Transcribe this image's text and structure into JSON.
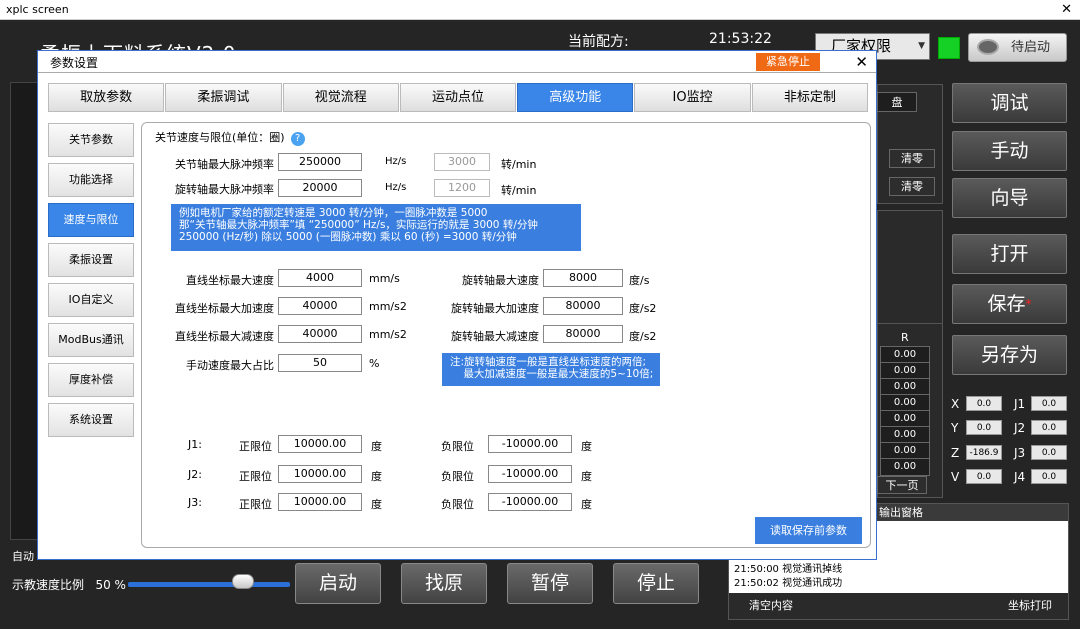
{
  "window": {
    "title": "xplc screen",
    "close": "✕"
  },
  "app": {
    "title": "柔振上下料系统V2.0",
    "recipe_label": "当前配方:",
    "clock": "21:53:22",
    "permission": "厂家权限",
    "status_button": "待启动",
    "auto_label": "自动",
    "speed_label": "示教速度比例",
    "speed_value": "50 %",
    "speed_fraction": 0.5,
    "side_buttons": [
      "调试",
      "手动",
      "向导",
      "打开",
      "保存",
      "另存为"
    ],
    "save_mark": "*",
    "partial_label": "盘",
    "clear_buttons": [
      "清零",
      "清零"
    ],
    "r_header": "R",
    "r_values": [
      "0.00",
      "0.00",
      "0.00",
      "0.00",
      "0.00",
      "0.00",
      "0.00",
      "0.00"
    ],
    "next_page": "下一页",
    "axes": [
      {
        "label": "X",
        "value": "0.0",
        "jlabel": "J1",
        "jvalue": "0.0"
      },
      {
        "label": "Y",
        "value": "0.0",
        "jlabel": "J2",
        "jvalue": "0.0"
      },
      {
        "label": "Z",
        "value": "-186.9",
        "jlabel": "J3",
        "jvalue": "0.0"
      },
      {
        "label": "V",
        "value": "0.0",
        "jlabel": "J4",
        "jvalue": "0.0"
      }
    ],
    "bottom_buttons": [
      "启动",
      "找原",
      "暂停",
      "停止"
    ],
    "log": {
      "title": "输出窗格",
      "lines": [
        "21:50:00  视觉通讯掉线",
        "21:50:02  视觉通讯成功"
      ],
      "clear": "清空内容",
      "print": "坐标打印"
    }
  },
  "dialog": {
    "title": "参数设置",
    "estop": "紧急停止",
    "close": "✕",
    "tabs": [
      "取放参数",
      "柔振调试",
      "视觉流程",
      "运动点位",
      "高级功能",
      "IO监控",
      "非标定制"
    ],
    "active_tab": 4,
    "sidebar": [
      "关节参数",
      "功能选择",
      "速度与限位",
      "柔振设置",
      "IO自定义",
      "ModBus通讯",
      "厚度补偿",
      "系统设置"
    ],
    "active_side": 2,
    "section_title": "关节速度与限位(单位：圈)",
    "help": "?",
    "pulse_rows": [
      {
        "label": "关节轴最大脉冲频率",
        "value": "250000",
        "unit": "Hz/s",
        "rpm": "3000",
        "rpm_unit": "转/min"
      },
      {
        "label": "旋转轴最大脉冲频率",
        "value": "20000",
        "unit": "Hz/s",
        "rpm": "1200",
        "rpm_unit": "转/min"
      }
    ],
    "note1": [
      "例如电机厂家给的额定转速是 3000 转/分钟，一圈脉冲数是 5000",
      "那“关节轴最大脉冲频率”填 “250000” Hz/s，实际运行的就是 3000 转/分钟",
      "250000 (Hz/秒) 除以 5000 (一圈脉冲数) 乘以 60 (秒) =3000 转/分钟"
    ],
    "linear": [
      {
        "label": "直线坐标最大速度",
        "value": "4000",
        "unit": "mm/s"
      },
      {
        "label": "直线坐标最大加速度",
        "value": "40000",
        "unit": "mm/s2"
      },
      {
        "label": "直线坐标最大减速度",
        "value": "40000",
        "unit": "mm/s2"
      }
    ],
    "rotary": [
      {
        "label": "旋转轴最大速度",
        "value": "8000",
        "unit": "度/s"
      },
      {
        "label": "旋转轴最大加速度",
        "value": "80000",
        "unit": "度/s2"
      },
      {
        "label": "旋转轴最大减速度",
        "value": "80000",
        "unit": "度/s2"
      }
    ],
    "manual": {
      "label": "手动速度最大占比",
      "value": "50",
      "unit": "%"
    },
    "note2": [
      "注:旋转轴速度一般是直线坐标速度的两倍;",
      "    最大加减速度一般是最大速度的5~10倍;"
    ],
    "limits": [
      {
        "joint": "J1:",
        "pos_label": "正限位",
        "pos": "10000.00",
        "pos_unit": "度",
        "neg_label": "负限位",
        "neg": "-10000.00",
        "neg_unit": "度"
      },
      {
        "joint": "J2:",
        "pos_label": "正限位",
        "pos": "10000.00",
        "pos_unit": "度",
        "neg_label": "负限位",
        "neg": "-10000.00",
        "neg_unit": "度"
      },
      {
        "joint": "J3:",
        "pos_label": "正限位",
        "pos": "10000.00",
        "pos_unit": "度",
        "neg_label": "负限位",
        "neg": "-10000.00",
        "neg_unit": "度"
      }
    ],
    "read_button": "读取保存前参数"
  }
}
